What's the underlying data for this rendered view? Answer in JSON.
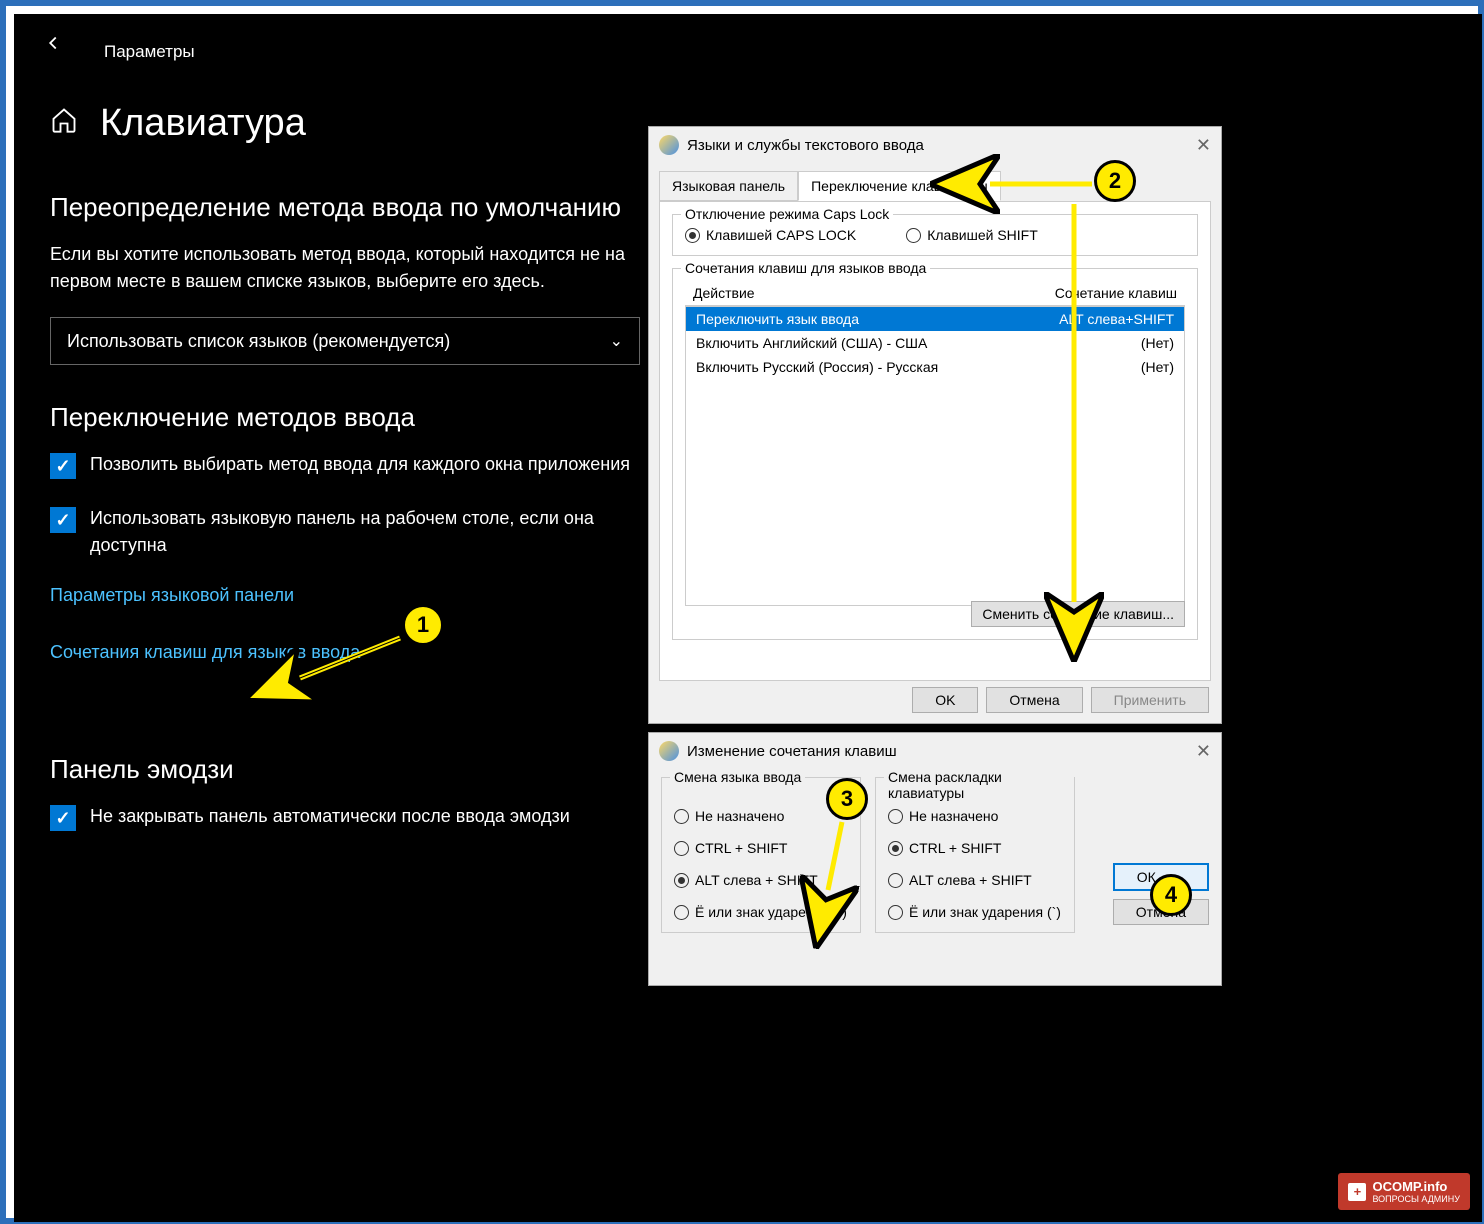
{
  "settings": {
    "app_name": "Параметры",
    "page_title": "Клавиатура",
    "override_heading": "Переопределение метода ввода по умолчанию",
    "override_text": "Если вы хотите использовать метод ввода, который находится не на первом месте в вашем списке языков, выберите его здесь.",
    "dropdown_value": "Использовать список языков (рекомендуется)",
    "switching_heading": "Переключение методов ввода",
    "chk1": "Позволить выбирать метод ввода для каждого окна приложения",
    "chk2": "Использовать языковую панель на рабочем столе, если она доступна",
    "link1": "Параметры языковой панели",
    "link2": "Сочетания клавиш для языков ввода",
    "emoji_heading": "Панель эмодзи",
    "chk3": "Не закрывать панель автоматически после ввода эмодзи"
  },
  "dialog1": {
    "title": "Языки и службы текстового ввода",
    "tab1": "Языковая панель",
    "tab2": "Переключение клавиатуры",
    "caps_group": "Отключение режима Caps Lock",
    "caps_opt1": "Клавишей CAPS LOCK",
    "caps_opt2": "Клавишей SHIFT",
    "hotkey_group": "Сочетания клавиш для языков ввода",
    "col1": "Действие",
    "col2": "Сочетание клавиш",
    "rows": [
      {
        "action": "Переключить язык ввода",
        "key": "ALT слева+SHIFT"
      },
      {
        "action": "Включить Английский (США) - США",
        "key": "(Нет)"
      },
      {
        "action": "Включить Русский (Россия) - Русская",
        "key": "(Нет)"
      }
    ],
    "change_btn": "Сменить сочетание клавиш...",
    "ok": "OK",
    "cancel": "Отмена",
    "apply": "Применить"
  },
  "dialog2": {
    "title": "Изменение сочетания клавиш",
    "group1": "Смена языка ввода",
    "group2": "Смена раскладки клавиатуры",
    "opt_none": "Не назначено",
    "opt_ctrl": "CTRL + SHIFT",
    "opt_alt": "ALT слева + SHIFT",
    "opt_yo": "Ё или знак ударения (`)",
    "ok": "OК",
    "cancel": "Отмена"
  },
  "badges": {
    "b1": "1",
    "b2": "2",
    "b3": "3",
    "b4": "4"
  },
  "watermark": {
    "main": "OCOMP",
    "suffix": ".info",
    "sub": "ВОПРОСЫ АДМИНУ"
  }
}
